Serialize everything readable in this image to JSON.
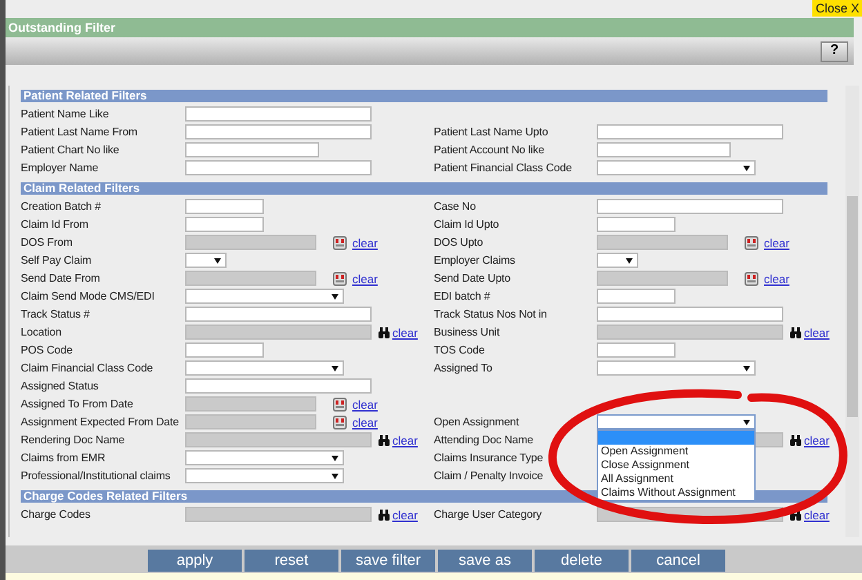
{
  "close_button": "Close X",
  "window": {
    "title": "Outstanding Filter"
  },
  "help_button": "?",
  "sections": [
    {
      "title": "Patient Related Filters",
      "rows": [
        {
          "left": {
            "label": "Patient Name Like",
            "kind": "text-long"
          }
        },
        {
          "left": {
            "label": "Patient Last Name From",
            "kind": "text-long"
          },
          "right": {
            "label": "Patient Last Name Upto",
            "kind": "text-long"
          }
        },
        {
          "left": {
            "label": "Patient Chart No like",
            "kind": "text"
          },
          "right": {
            "label": "Patient Account No like",
            "kind": "text"
          }
        },
        {
          "left": {
            "label": "Employer Name",
            "kind": "text-long"
          },
          "right": {
            "label": "Patient Financial Class Code",
            "kind": "select"
          }
        }
      ]
    },
    {
      "title": "Claim Related Filters",
      "rows": [
        {
          "left": {
            "label": "Creation Batch #",
            "kind": "text-short"
          },
          "right": {
            "label": "Case No",
            "kind": "text-long"
          }
        },
        {
          "left": {
            "label": "Claim Id From",
            "kind": "text-short"
          },
          "right": {
            "label": "Claim Id Upto",
            "kind": "text-short"
          }
        },
        {
          "left": {
            "label": "DOS From",
            "kind": "date",
            "link": "clear"
          },
          "right": {
            "label": "DOS Upto",
            "kind": "date",
            "link": "clear"
          }
        },
        {
          "left": {
            "label": "Self Pay Claim",
            "kind": "select-small"
          },
          "right": {
            "label": "Employer Claims",
            "kind": "select-small"
          }
        },
        {
          "left": {
            "label": "Send Date From",
            "kind": "date",
            "link": "clear"
          },
          "right": {
            "label": "Send Date Upto",
            "kind": "date",
            "link": "clear"
          }
        },
        {
          "left": {
            "label": "Claim Send Mode CMS/EDI",
            "kind": "select"
          },
          "right": {
            "label": "EDI batch #",
            "kind": "text-short"
          }
        },
        {
          "left": {
            "label": "Track Status #",
            "kind": "text-long"
          },
          "right": {
            "label": "Track Status Nos Not in",
            "kind": "text-long"
          }
        },
        {
          "left": {
            "label": "Location",
            "kind": "lookup",
            "link": "clear"
          },
          "right": {
            "label": "Business Unit",
            "kind": "lookup",
            "link": "clear"
          }
        },
        {
          "left": {
            "label": "POS Code",
            "kind": "text-short"
          },
          "right": {
            "label": "TOS Code",
            "kind": "text-short"
          }
        },
        {
          "left": {
            "label": "Claim Financial Class Code",
            "kind": "select"
          },
          "right": {
            "label": "Assigned To",
            "kind": "select"
          }
        },
        {
          "left": {
            "label": "Assigned Status",
            "kind": "text-long"
          }
        },
        {
          "left": {
            "label": "Assigned To From Date",
            "kind": "date",
            "link": "clear"
          }
        },
        {
          "left": {
            "label": "Assignment Expected From Date",
            "kind": "date",
            "link": "clear"
          },
          "right": {
            "label": "Open Assignment",
            "kind": "select",
            "expanded": true,
            "options": [
              {
                "selected": true
              },
              {
                "label": "Open Assignment",
                "selected": false
              },
              {
                "label": "Close Assignment",
                "selected": false
              },
              {
                "label": "All Assignment",
                "selected": false
              },
              {
                "label": "Claims Without Assignment",
                "selected": false
              }
            ]
          }
        },
        {
          "left": {
            "label": "Rendering Doc Name",
            "kind": "lookup",
            "link": "clear"
          },
          "right": {
            "label": "Attending Doc Name",
            "kind": "lookup",
            "link": "clear"
          }
        },
        {
          "left": {
            "label": "Claims from EMR",
            "kind": "select"
          },
          "right": {
            "label": "Claims Insurance Type"
          }
        },
        {
          "left": {
            "label": "Professional/Institutional claims",
            "kind": "select"
          },
          "right": {
            "label": "Claim / Penalty Invoice"
          }
        }
      ]
    },
    {
      "title": "Charge Codes Related Filters",
      "rows": [
        {
          "left": {
            "label": "Charge Codes",
            "kind": "lookup",
            "link": "clear"
          },
          "right": {
            "label": "Charge User Category",
            "kind": "lookup",
            "link": "clear"
          }
        }
      ]
    }
  ],
  "buttons": [
    "apply",
    "reset",
    "save filter",
    "save as",
    "delete",
    "cancel"
  ]
}
